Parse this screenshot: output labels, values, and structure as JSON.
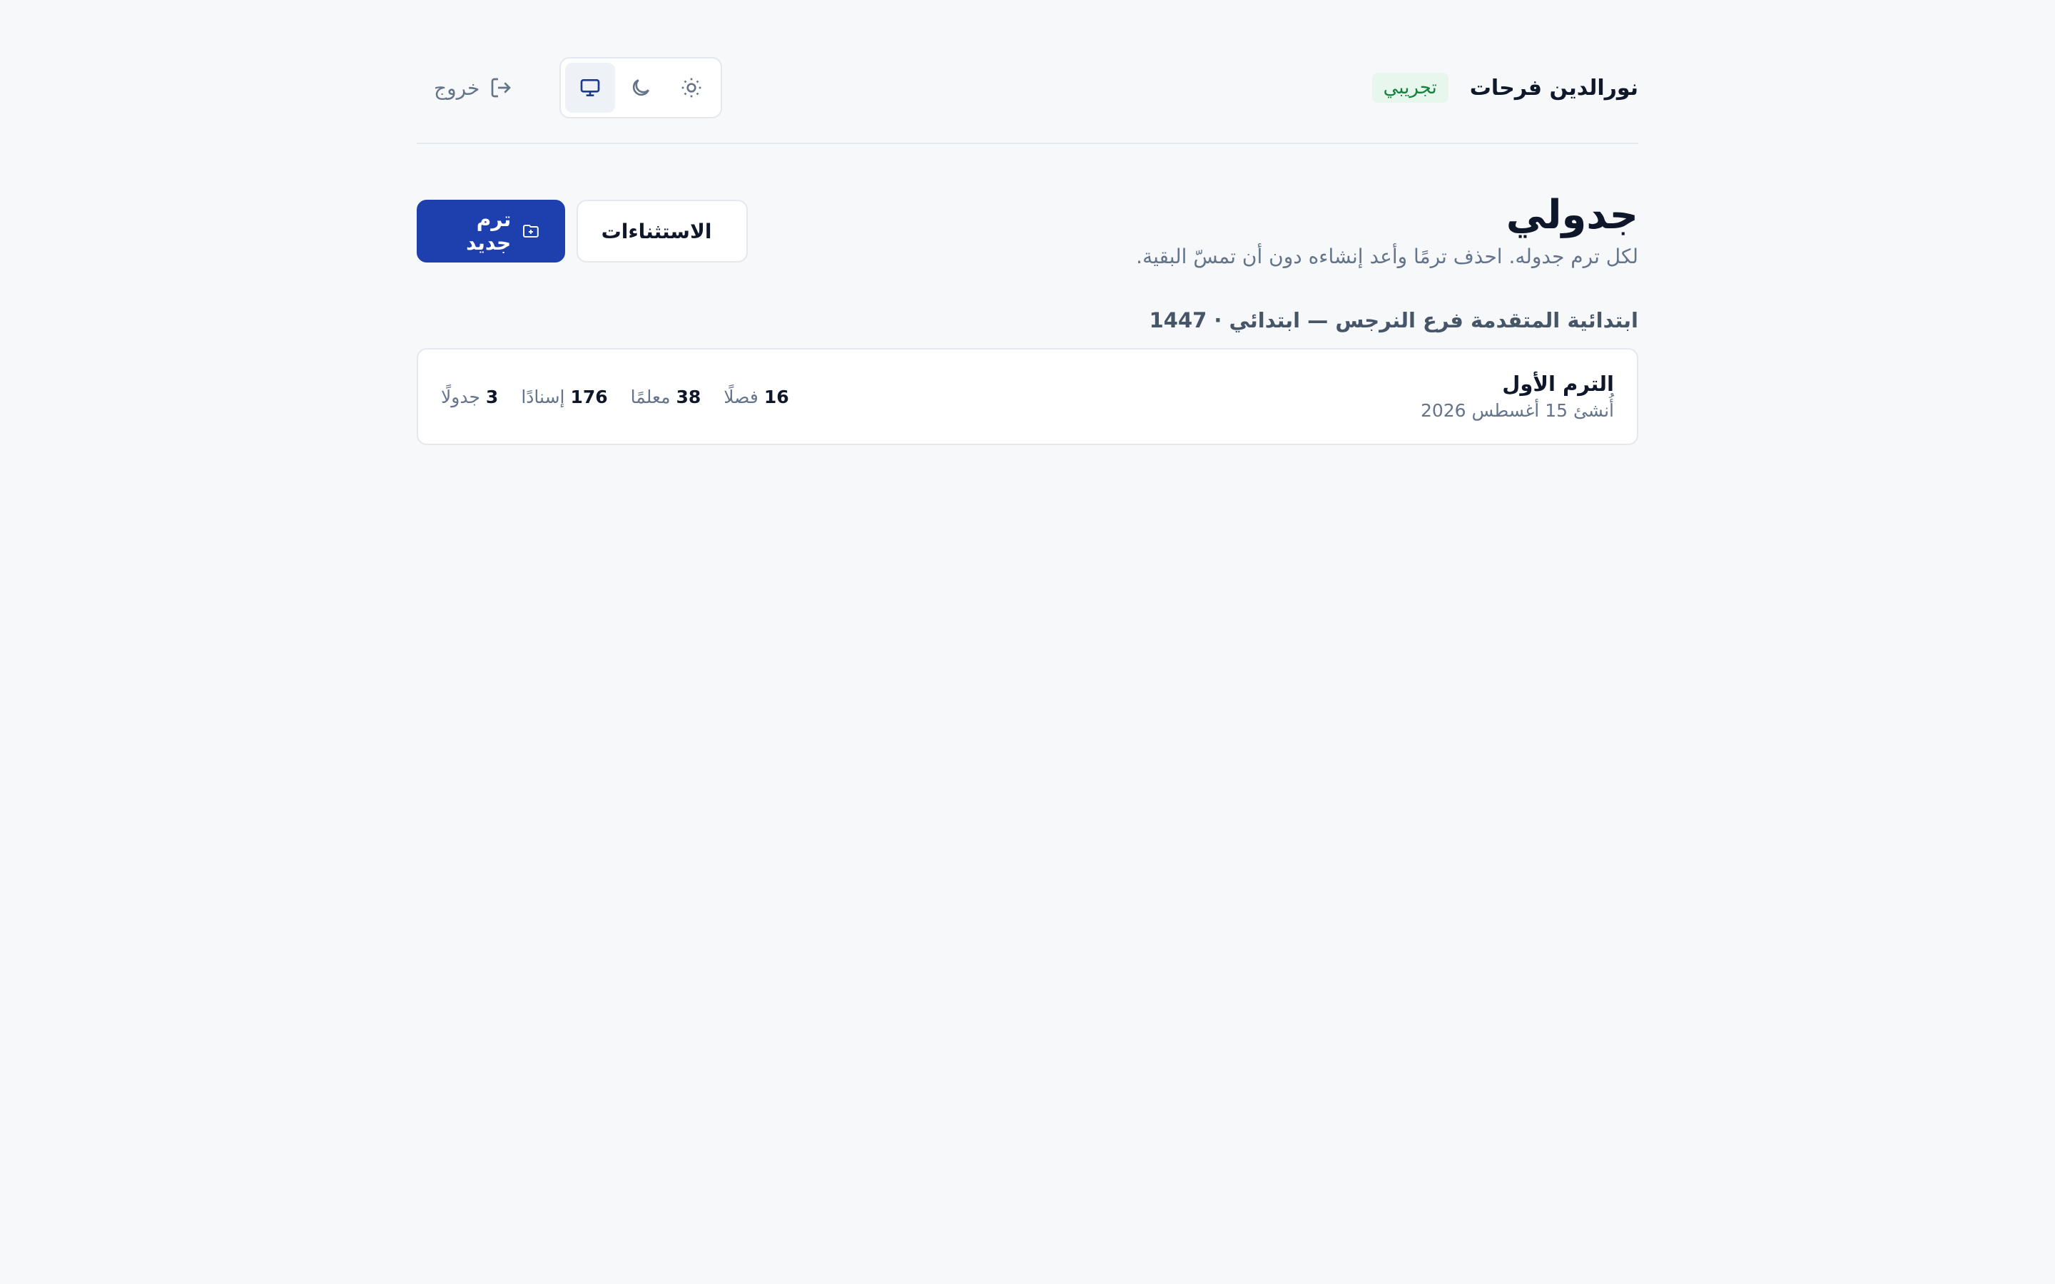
{
  "header": {
    "user_name": "نورالدين فرحات",
    "badge": "تجريبي",
    "theme_options": [
      "light",
      "dark",
      "system"
    ],
    "active_theme": "system",
    "logout_label": "خروج"
  },
  "page": {
    "title": "جدولي",
    "subtitle": "لكل ترم جدوله. احذف ترمًا وأعد إنشاءه دون أن تمسّ البقية.",
    "exceptions_label": "الاستثناءات",
    "new_term_label": "ترم جديد"
  },
  "groups": [
    {
      "title": "ابتدائية المتقدمة فرع النرجس — ابتدائي · 1447",
      "terms": [
        {
          "name": "الترم الأول",
          "created": "أُنشئ 15 أغسطس 2026",
          "stats": [
            {
              "num": "16",
              "label": "فصلًا"
            },
            {
              "num": "38",
              "label": "معلمًا"
            },
            {
              "num": "176",
              "label": "إسنادًا"
            },
            {
              "num": "3",
              "label": "جدولًا"
            }
          ]
        }
      ]
    }
  ],
  "colors": {
    "primary": "#1e40af",
    "background": "#f6f8fa",
    "badge_bg": "#e7f7ee",
    "badge_text": "#15803d"
  }
}
